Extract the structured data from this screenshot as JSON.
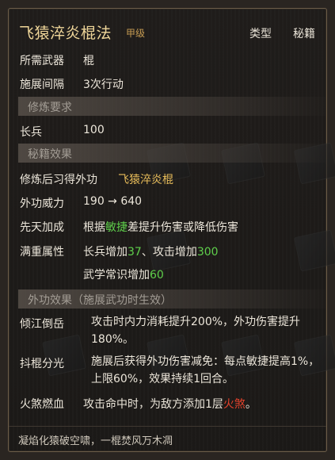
{
  "title": "飞猿淬炎棍法",
  "grade": "甲级",
  "type_label": "类型",
  "type_value": "秘籍",
  "weapon_label": "所需武器",
  "weapon_value": "棍",
  "interval_label": "施展间隔",
  "interval_value": "3次行动",
  "section_req": "修炼要求",
  "req_label": "长兵",
  "req_value": "100",
  "section_effect": "秘籍效果",
  "learn_label": "修炼后习得外功",
  "learn_value": "飞猿淬炎棍",
  "power_label": "外功威力",
  "power_value": "190 → 640",
  "innate_label": "先天加成",
  "innate_pre": "根据",
  "innate_hl": "敏捷",
  "innate_post": "差提升伤害或降低伤害",
  "full_label": "满重属性",
  "full1_a": "长兵增加",
  "full1_b": "37",
  "full1_c": "、攻击增加",
  "full1_d": "300",
  "full2_a": "武学常识增加",
  "full2_b": "60",
  "section_ext": "外功效果（施展武功时生效）",
  "eff1_label": "倾江倒岳",
  "eff1_text": "攻击时内力消耗提升200%，外功伤害提升180%。",
  "eff2_label": "抖棍分光",
  "eff2_text": "施展后获得外功伤害减免：每点敏捷提高1%，上限60%，效果持续1回合。",
  "eff3_label": "火煞燃血",
  "eff3_pre": "攻击命中时，为敌方添加1层",
  "eff3_hl": "火煞",
  "eff3_post": "。",
  "footer": "凝焰化猿破空啸，一棍焚风万木凋",
  "colors": {
    "title": "#f0d79a",
    "gold": "#e9bd5a",
    "green": "#5fcf4b",
    "red": "#e2422c"
  }
}
